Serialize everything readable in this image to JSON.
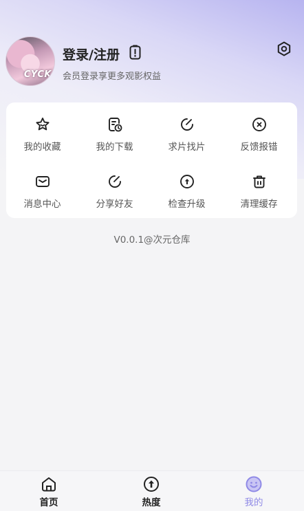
{
  "profile": {
    "avatar_text": "CYCK",
    "login_label": "登录/注册",
    "subtitle": "会员登录享更多观影权益",
    "badge_icon": "shield-alert-icon",
    "settings_icon": "gear-icon"
  },
  "menu": {
    "items": [
      {
        "label": "我的收藏",
        "icon": "star-icon"
      },
      {
        "label": "我的下载",
        "icon": "download-clock-icon"
      },
      {
        "label": "求片找片",
        "icon": "edit-icon"
      },
      {
        "label": "反馈报错",
        "icon": "close-circle-icon"
      },
      {
        "label": "消息中心",
        "icon": "mail-icon"
      },
      {
        "label": "分享好友",
        "icon": "share-edit-icon"
      },
      {
        "label": "检查升级",
        "icon": "upload-circle-icon"
      },
      {
        "label": "清理缓存",
        "icon": "trash-icon"
      }
    ]
  },
  "version": "V0.0.1@次元仓库",
  "tabbar": {
    "tabs": [
      {
        "label": "首页",
        "icon": "home-icon"
      },
      {
        "label": "热度",
        "icon": "arrow-up-circle-icon"
      },
      {
        "label": "我的",
        "icon": "smile-icon",
        "active": true
      }
    ],
    "active_color": "#8f89e6"
  }
}
